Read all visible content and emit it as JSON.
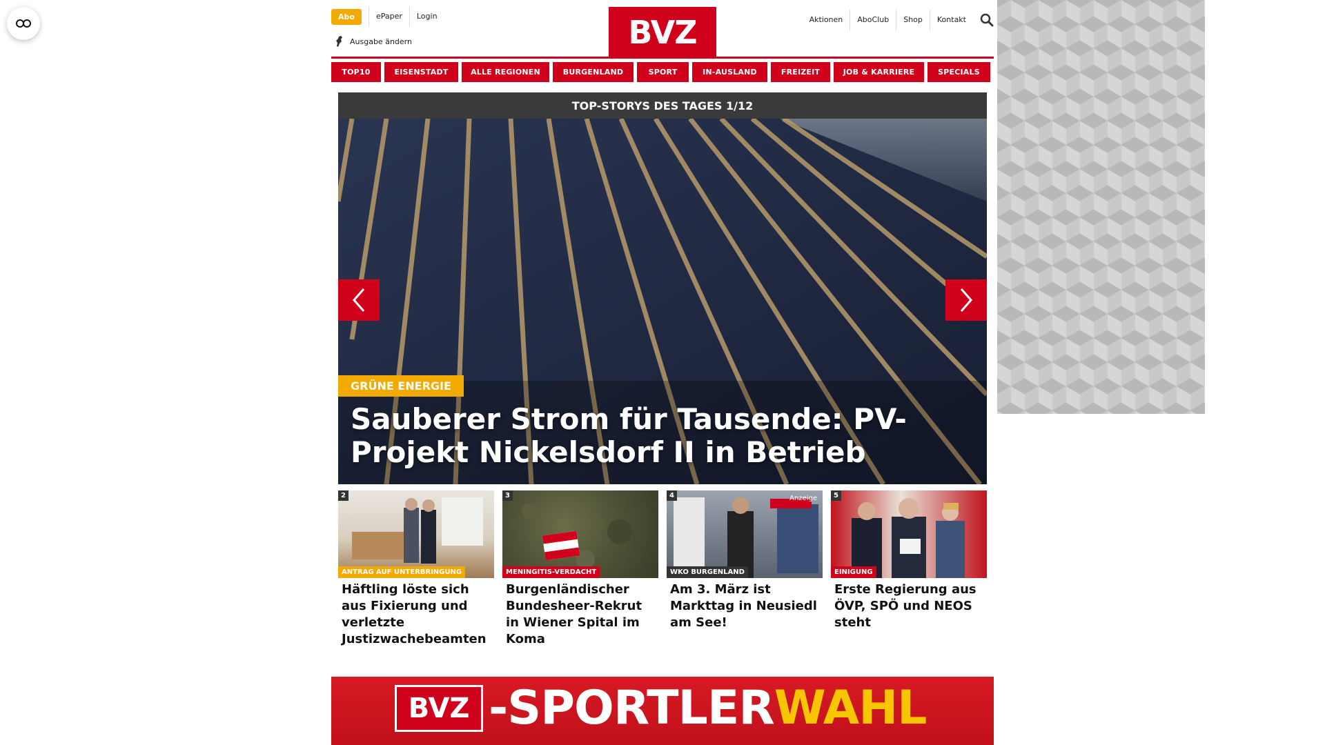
{
  "header": {
    "abo_label": "Abo",
    "epaper_label": "ePaper",
    "login_label": "Login",
    "ausgabe_label": "Ausgabe ändern",
    "logo_text": "BVZ",
    "right_links": [
      "Aktionen",
      "AboClub",
      "Shop",
      "Kontakt"
    ],
    "search_icon": "search-icon"
  },
  "nav": {
    "items": [
      "TOP10",
      "EISENSTADT",
      "ALLE REGIONEN",
      "BURGENLAND",
      "SPORT",
      "IN-AUSLAND",
      "FREIZEIT",
      "JOB & KARRIERE",
      "SPECIALS"
    ]
  },
  "slider": {
    "heading": "TOP-STORYS DES TAGES 1/12",
    "kicker": "GRÜNE ENERGIE",
    "title": "Sauberer Strom für Tausende: PV-Projekt Nickelsdorf II in Betrieb"
  },
  "teasers": [
    {
      "num": "2",
      "kicker": "ANTRAG AUF UNTERBRINGUNG",
      "kicker_color": "#f2a900",
      "title": "Häftling löste sich aus Fixierung und verletzte Justizwachebeamten",
      "anzeige": ""
    },
    {
      "num": "3",
      "kicker": "MENINGITIS-VERDACHT",
      "kicker_color": "#d0021b",
      "title": "Burgenländischer Bundesheer-Rekrut in Wiener Spital im Koma",
      "anzeige": ""
    },
    {
      "num": "4",
      "kicker": "WKO BURGENLAND",
      "kicker_color": "#333333",
      "title": "Am 3. März ist Markttag in Neusiedl am See!",
      "anzeige": "Anzeige"
    },
    {
      "num": "5",
      "kicker": "EINIGUNG",
      "kicker_color": "#d0021b",
      "title": "Erste Regierung aus ÖVP, SPÖ und NEOS steht",
      "anzeige": ""
    }
  ],
  "banner": {
    "logo_text": "BVZ",
    "text_white": "-SPORTLER",
    "text_yellow": "WAHL"
  },
  "colors": {
    "brand_red": "#d0021b",
    "abo_yellow": "#f2a900"
  }
}
